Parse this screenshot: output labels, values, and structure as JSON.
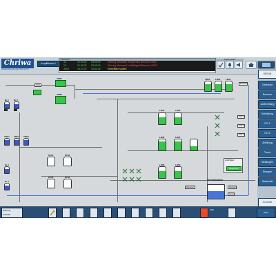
{
  "header": {
    "logo": "Chriwa",
    "logo_sub": "Wasseraufbereitungstechnik GmbH",
    "user": "ln optMonex 1",
    "messages_caption": "Meldungen",
    "status_caption": "Anlage Betrieb",
    "messages": [
      {
        "nr": "43",
        "date": "21.03.22",
        "time": "03:55:00",
        "text": "Störung Messwert Temperatur Brunnen VBE2"
      },
      {
        "nr": "12",
        "date": "21.03.22",
        "time": "03:55:00",
        "text": "Störung Messwert Leitfähigkeit Brunnen VBE2"
      },
      {
        "nr": "3004",
        "date": "18.03.22",
        "time": "16:30:44",
        "text": "Kieselfilter spülen"
      }
    ]
  },
  "nav": {
    "top": "BEEAB",
    "items": [
      "Übersicht",
      "Brunnen",
      "Aufbereitung",
      "Enthärtung",
      "RO 1",
      "RO 2",
      "Abfüllung",
      "Trend",
      "Meldungen",
      "Rezepte",
      "Sicherheit"
    ],
    "bottom": "Kontrolle"
  },
  "plant": {
    "pumps_left": [
      "Br 1",
      "Br 2",
      "Br 3",
      "Br 4"
    ],
    "vessels": [
      "VBE1",
      "VBE2",
      "VBE3"
    ],
    "filters": [
      "KF01",
      "KF02",
      "KF03",
      "KF04"
    ],
    "vbb_top": [
      "VBB1",
      "VBB2"
    ],
    "ro_top": [
      "LB01",
      "LB02",
      "LB03"
    ],
    "ro_mid": [
      "LB04",
      "LB05",
      "LB06",
      "LB07"
    ],
    "ro_bottom": [
      "LB08",
      "LB09",
      "LB10"
    ],
    "flow_out": "Permeat",
    "lines": [
      "Linie 1",
      "Linie 2",
      "Linie 3"
    ],
    "neutral_title": "Neutralisation",
    "neutral_box": "Leitfähigkeit",
    "neutral_value": "0000 µS/cm",
    "outlet_label": "Abwasser",
    "kanal": "Kanal",
    "ueberlauf": "Überlauf"
  },
  "footer": {
    "left": "Wartung",
    "left2": "Startbild",
    "center": "SPS",
    "right": "Mitte"
  },
  "colors": {
    "nav_button": "#2b5f8f",
    "tank_fill": "#39c44a",
    "water_line": "#4a74d6",
    "display_text": "#50e050"
  }
}
